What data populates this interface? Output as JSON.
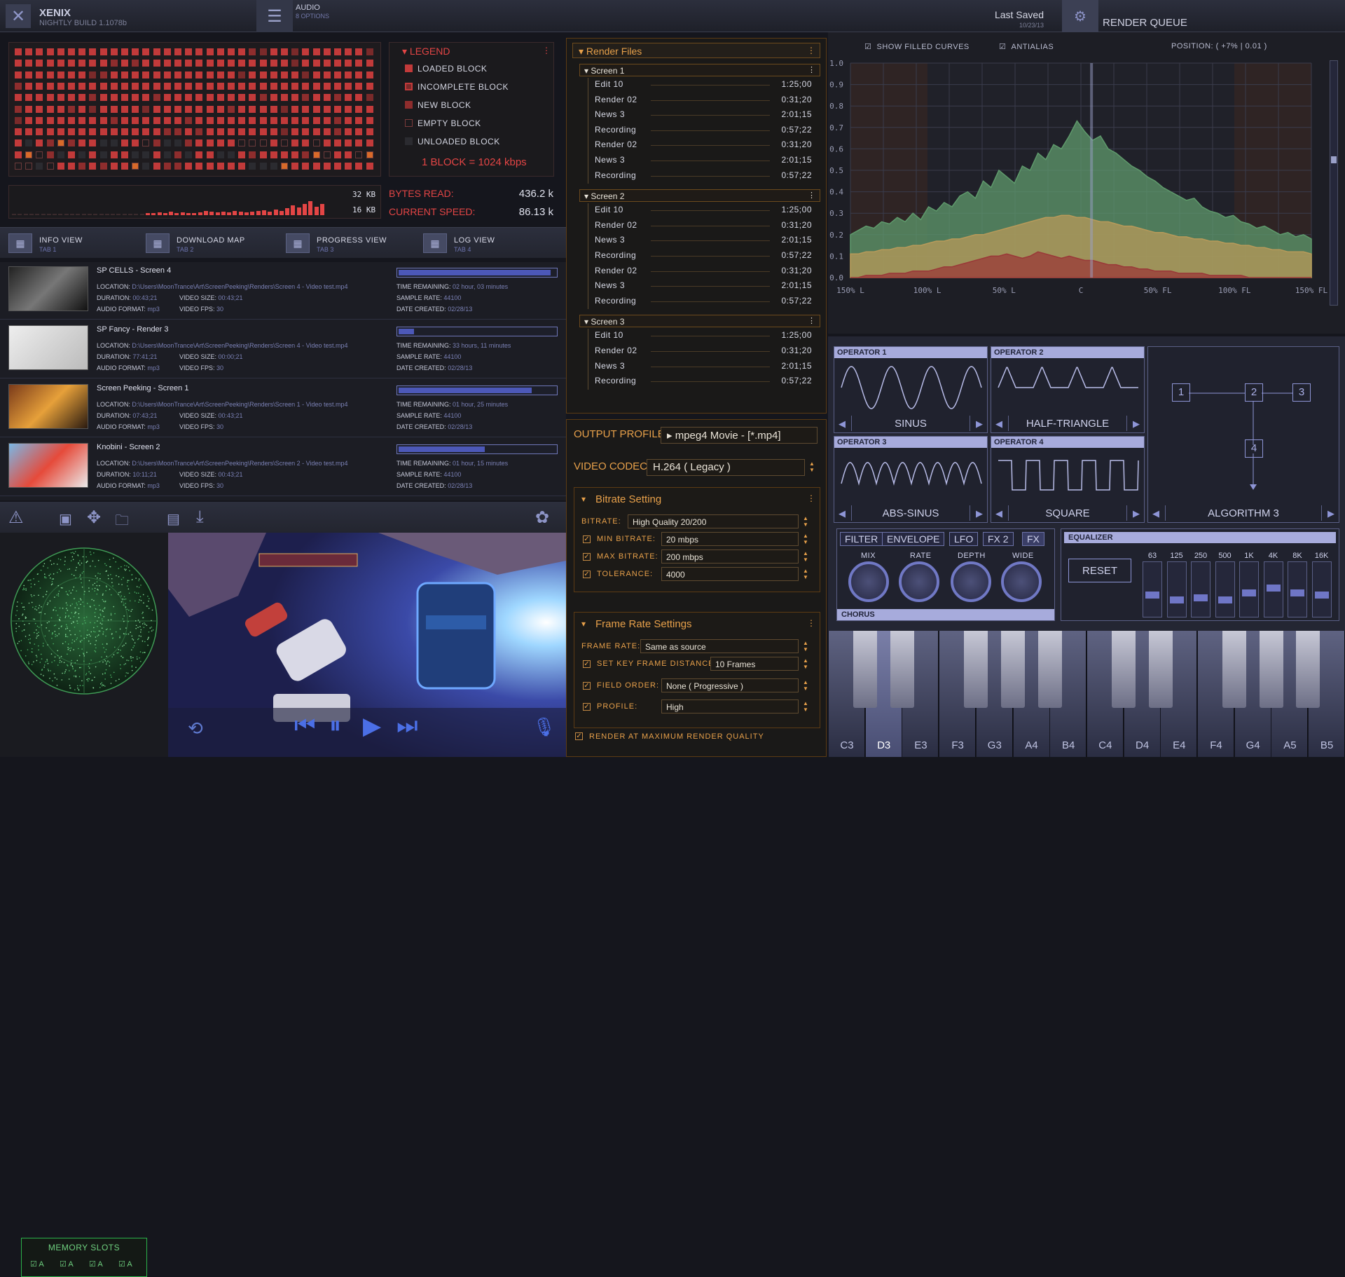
{
  "app": {
    "name": "XENIX",
    "build": "NIGHTLY BUILD 1.1078b"
  },
  "audio": {
    "title": "AUDIO",
    "sub": "8 OPTIONS"
  },
  "save": {
    "label": "Last Saved",
    "date": "10/23/13"
  },
  "render_queue": {
    "title": "RENDER QUEUE"
  },
  "legend": {
    "title": "LEGEND",
    "items": [
      "LOADED BLOCK",
      "INCOMPLETE BLOCK",
      "NEW BLOCK",
      "EMPTY BLOCK",
      "UNLOADED BLOCK"
    ],
    "note": "1 BLOCK = 1024 kbps"
  },
  "bytes": {
    "kb32": "32 KB",
    "kb16": "16 KB",
    "read_label": "BYTES READ:",
    "read_val": "436.2 k",
    "speed_label": "CURRENT SPEED:",
    "speed_val": "86.13 k"
  },
  "tabs": [
    {
      "title": "INFO VIEW",
      "sub": "TAB 1"
    },
    {
      "title": "DOWNLOAD MAP",
      "sub": "TAB 2"
    },
    {
      "title": "PROGRESS VIEW",
      "sub": "TAB 3"
    },
    {
      "title": "LOG VIEW",
      "sub": "TAB 4"
    }
  ],
  "videos": [
    {
      "title": "SP CELLS - Screen 4",
      "location": "D:\\Users\\MoonTrance\\Art\\ScreenPeeking\\Renders\\Screen 4 - Video test.mp4",
      "duration": "00:43;21",
      "video_size": "00:43;21",
      "audio_format": "mp3",
      "video_fps": "30",
      "time_remaining": "02 hour, 03 minutes",
      "sample_rate": "44100",
      "date_created": "02/28/13",
      "progress": 0.97
    },
    {
      "title": "SP Fancy - Render 3",
      "location": "D:\\Users\\MoonTrance\\Art\\ScreenPeeking\\Renders\\Screen 4 - Video test.mp4",
      "duration": "77:41;21",
      "video_size": "00:00;21",
      "audio_format": "mp3",
      "video_fps": "30",
      "time_remaining": "33 hours, 11 minutes",
      "sample_rate": "44100",
      "date_created": "02/28/13",
      "progress": 0.1
    },
    {
      "title": "Screen Peeking - Screen 1",
      "location": "D:\\Users\\MoonTrance\\Art\\ScreenPeeking\\Renders\\Screen 1 - Video test.mp4",
      "duration": "07:43;21",
      "video_size": "00:43;21",
      "audio_format": "mp3",
      "video_fps": "30",
      "time_remaining": "01 hour, 25 minutes",
      "sample_rate": "44100",
      "date_created": "02/28/13",
      "progress": 0.85
    },
    {
      "title": "Knobini - Screen 2",
      "location": "D:\\Users\\MoonTrance\\Art\\ScreenPeeking\\Renders\\Screen 2 - Video test.mp4",
      "duration": "10:11;21",
      "video_size": "00:43;21",
      "audio_format": "mp3",
      "video_fps": "30",
      "time_remaining": "01 hour, 15 minutes",
      "sample_rate": "44100",
      "date_created": "02/28/13",
      "progress": 0.55
    }
  ],
  "field_labels": {
    "location": "LOCATION:",
    "duration": "DURATION:",
    "video_size": "VIDEO SIZE:",
    "audio_format": "AUDIO FORMAT:",
    "video_fps": "VIDEO FPS:",
    "time_remaining": "TIME REMAINING:",
    "sample_rate": "SAMPLE RATE:",
    "date_created": "DATE CREATED:"
  },
  "memory": {
    "title": "MEMORY SLOTS",
    "slots": [
      "A",
      "A",
      "A",
      "A"
    ]
  },
  "render_files": {
    "title": "Render Files",
    "groups": [
      {
        "name": "Screen 1",
        "rows": [
          [
            "Edit 10",
            "1:25;00"
          ],
          [
            "Render 02",
            "0:31;20"
          ],
          [
            "News 3",
            "2:01;15"
          ],
          [
            "Recording",
            "0:57;22"
          ],
          [
            "Render 02",
            "0:31;20"
          ],
          [
            "News 3",
            "2:01;15"
          ],
          [
            "Recording",
            "0:57;22"
          ]
        ]
      },
      {
        "name": "Screen 2",
        "rows": [
          [
            "Edit 10",
            "1:25;00"
          ],
          [
            "Render 02",
            "0:31;20"
          ],
          [
            "News 3",
            "2:01;15"
          ],
          [
            "Recording",
            "0:57;22"
          ],
          [
            "Render 02",
            "0:31;20"
          ],
          [
            "News 3",
            "2:01;15"
          ],
          [
            "Recording",
            "0:57;22"
          ]
        ]
      },
      {
        "name": "Screen 3",
        "rows": [
          [
            "Edit 10",
            "1:25;00"
          ],
          [
            "Render 02",
            "0:31;20"
          ],
          [
            "News 3",
            "2:01;15"
          ],
          [
            "Recording",
            "0:57;22"
          ]
        ]
      }
    ]
  },
  "output": {
    "profile_label": "OUTPUT PROFILE:",
    "profile_val": "mpeg4 Movie  -  [*.mp4]",
    "codec_label": "VIDEO CODEC:",
    "codec_val": "H.264 ( Legacy )",
    "bitrate_title": "Bitrate Setting",
    "bitrate_label": "BITRATE:",
    "bitrate_val": "High Quality 20/200",
    "min_label": "MIN BITRATE:",
    "min_val": "20 mbps",
    "max_label": "MAX BITRATE:",
    "max_val": "200 mbps",
    "tol_label": "TOLERANCE:",
    "tol_val": "4000",
    "frame_title": "Frame Rate Settings",
    "fr_label": "FRAME RATE:",
    "fr_val": "Same as source",
    "kf_label": "SET KEY FRAME DISTANCE:",
    "kf_val": "10 Frames",
    "fo_label": "FIELD ORDER:",
    "fo_val": "None ( Progressive )",
    "pr_label": "PROFILE:",
    "pr_val": "High",
    "max_quality": "RENDER AT MAXIMUM RENDER QUALITY"
  },
  "chart_opts": {
    "filled": "SHOW FILLED CURVES",
    "antialias": "ANTIALIAS",
    "position": "POSITION:   ( +7%   |   0.01  )"
  },
  "chart_data": {
    "type": "area",
    "y_ticks": [
      "1.0",
      "0.9",
      "0.8",
      "0.7",
      "0.6",
      "0.5",
      "0.4",
      "0.3",
      "0.2",
      "0.1",
      "0.0"
    ],
    "x_ticks": [
      "150% L",
      "100% L",
      "50% L",
      "C",
      "50% FL",
      "100% FL",
      "150% FL"
    ],
    "ylim": [
      0,
      1
    ],
    "green": [
      0.2,
      0.22,
      0.24,
      0.23,
      0.26,
      0.25,
      0.28,
      0.26,
      0.3,
      0.27,
      0.33,
      0.31,
      0.35,
      0.33,
      0.38,
      0.4,
      0.37,
      0.45,
      0.42,
      0.5,
      0.47,
      0.44,
      0.52,
      0.5,
      0.58,
      0.55,
      0.62,
      0.6,
      0.66,
      0.73,
      0.68,
      0.64,
      0.66,
      0.6,
      0.58,
      0.55,
      0.52,
      0.5,
      0.47,
      0.45,
      0.42,
      0.4,
      0.38,
      0.36,
      0.37,
      0.33,
      0.31,
      0.3,
      0.28,
      0.29,
      0.26,
      0.25,
      0.23,
      0.24,
      0.22,
      0.2,
      0.21,
      0.19,
      0.2,
      0.18
    ],
    "yellow": [
      0.11,
      0.11,
      0.12,
      0.12,
      0.13,
      0.13,
      0.14,
      0.14,
      0.15,
      0.15,
      0.16,
      0.17,
      0.17,
      0.18,
      0.18,
      0.19,
      0.2,
      0.2,
      0.21,
      0.22,
      0.23,
      0.24,
      0.25,
      0.26,
      0.27,
      0.28,
      0.28,
      0.29,
      0.29,
      0.28,
      0.28,
      0.27,
      0.26,
      0.26,
      0.25,
      0.24,
      0.24,
      0.23,
      0.22,
      0.21,
      0.21,
      0.2,
      0.19,
      0.19,
      0.18,
      0.18,
      0.17,
      0.17,
      0.16,
      0.16,
      0.15,
      0.15,
      0.14,
      0.14,
      0.13,
      0.13,
      0.12,
      0.12,
      0.12,
      0.11
    ],
    "red": [
      0.0,
      0.0,
      0.01,
      0.01,
      0.01,
      0.02,
      0.02,
      0.02,
      0.03,
      0.03,
      0.03,
      0.04,
      0.05,
      0.05,
      0.06,
      0.07,
      0.08,
      0.09,
      0.1,
      0.1,
      0.11,
      0.1,
      0.09,
      0.1,
      0.12,
      0.11,
      0.1,
      0.09,
      0.1,
      0.09,
      0.08,
      0.08,
      0.07,
      0.06,
      0.06,
      0.05,
      0.05,
      0.04,
      0.04,
      0.03,
      0.03,
      0.03,
      0.02,
      0.02,
      0.02,
      0.02,
      0.01,
      0.01,
      0.01,
      0.01,
      0.01,
      0.0,
      0.0,
      0.0,
      0.0,
      0.0,
      0.0,
      0.0,
      0.0,
      0.0
    ],
    "colors": {
      "green": "#5f9a6c",
      "yellow": "#b89a5a",
      "red": "#9a3838"
    }
  },
  "operators": [
    {
      "head": "OPERATOR 1",
      "name": "SINUS"
    },
    {
      "head": "OPERATOR 2",
      "name": "HALF-TRIANGLE"
    },
    {
      "head": "OPERATOR 3",
      "name": "ABS-SINUS"
    },
    {
      "head": "OPERATOR 4",
      "name": "SQUARE"
    }
  ],
  "algorithm": {
    "name": "ALGORITHM 3",
    "nodes": [
      "1",
      "2",
      "3",
      "4"
    ]
  },
  "fx": {
    "tabs": [
      "FILTER",
      "ENVELOPE",
      "LFO",
      "FX 2",
      "FX"
    ],
    "knobs": [
      "MIX",
      "RATE",
      "DEPTH",
      "WIDE"
    ],
    "footer": "CHORUS"
  },
  "eq": {
    "title": "EQUALIZER",
    "reset": "RESET",
    "bands": [
      "63",
      "125",
      "250",
      "500",
      "1K",
      "4K",
      "8K",
      "16K"
    ],
    "levels": [
      0.4,
      0.3,
      0.35,
      0.3,
      0.45,
      0.55,
      0.45,
      0.4
    ]
  },
  "piano": {
    "notes": [
      "C3",
      "D3",
      "E3",
      "F3",
      "G3",
      "A4",
      "B4",
      "C4",
      "D4",
      "E4",
      "F4",
      "G4",
      "A5",
      "B5"
    ],
    "active": "D3"
  }
}
